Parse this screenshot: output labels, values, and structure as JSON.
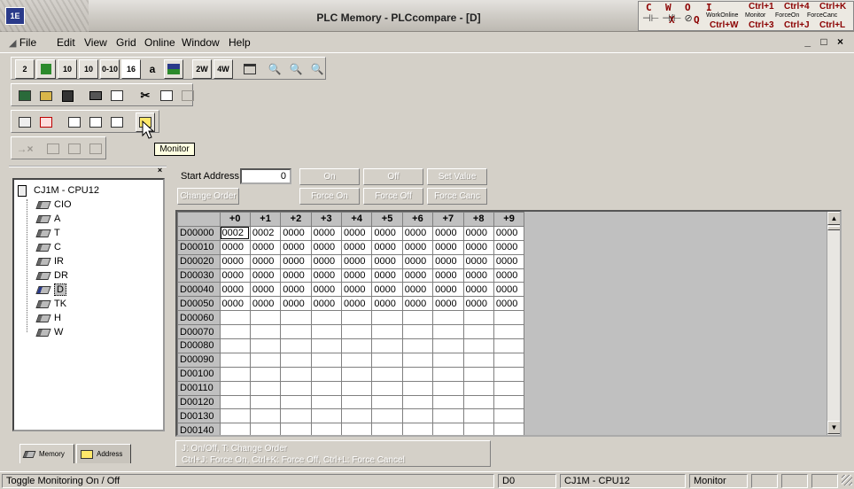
{
  "window": {
    "title": "PLC Memory - PLCcompare - [D]",
    "icon_text": "1E"
  },
  "shortcuts": {
    "glyphs": [
      "C",
      "W",
      "O",
      "I",
      "X",
      "Q"
    ],
    "small_labels": [
      "WorkOnline",
      "Monitor",
      "ForceOn",
      "ForceCanc"
    ],
    "keys_row1": [
      "Ctrl+1",
      "Ctrl+4",
      "Ctrl+K"
    ],
    "keys_row2": [
      "Ctrl+W",
      "Ctrl+3",
      "Ctrl+J",
      "Ctrl+L"
    ]
  },
  "menu": {
    "items": [
      "File",
      "Edit",
      "View",
      "Grid",
      "Online",
      "Window",
      "Help"
    ],
    "mdi_controls": "_ □ ×"
  },
  "toolbar1": {
    "buttons": [
      "2",
      "",
      "10",
      "10",
      "0-10",
      "16",
      "a",
      "",
      "2W",
      "4W",
      "",
      "",
      "",
      ""
    ]
  },
  "tooltip": "Monitor",
  "tree": {
    "root": "CJ1M - CPU12",
    "items": [
      "CIO",
      "A",
      "T",
      "C",
      "IR",
      "DR",
      "D",
      "TK",
      "H",
      "W"
    ],
    "selected": "D"
  },
  "left_tabs": [
    "Memory",
    "Address"
  ],
  "controls": {
    "start_address_label": "Start Address:",
    "start_address_value": "0",
    "buttons_row1": [
      "On",
      "Off",
      "Set Value"
    ],
    "buttons_row2": [
      "Change Order",
      "Force On",
      "Force Off",
      "Force Canc"
    ]
  },
  "grid": {
    "columns": [
      "+0",
      "+1",
      "+2",
      "+3",
      "+4",
      "+5",
      "+6",
      "+7",
      "+8",
      "+9"
    ],
    "rows": [
      {
        "addr": "D00000",
        "values": [
          "0002",
          "0002",
          "0000",
          "0000",
          "0000",
          "0000",
          "0000",
          "0000",
          "0000",
          "0000"
        ]
      },
      {
        "addr": "D00010",
        "values": [
          "0000",
          "0000",
          "0000",
          "0000",
          "0000",
          "0000",
          "0000",
          "0000",
          "0000",
          "0000"
        ]
      },
      {
        "addr": "D00020",
        "values": [
          "0000",
          "0000",
          "0000",
          "0000",
          "0000",
          "0000",
          "0000",
          "0000",
          "0000",
          "0000"
        ]
      },
      {
        "addr": "D00030",
        "values": [
          "0000",
          "0000",
          "0000",
          "0000",
          "0000",
          "0000",
          "0000",
          "0000",
          "0000",
          "0000"
        ]
      },
      {
        "addr": "D00040",
        "values": [
          "0000",
          "0000",
          "0000",
          "0000",
          "0000",
          "0000",
          "0000",
          "0000",
          "0000",
          "0000"
        ]
      },
      {
        "addr": "D00050",
        "values": [
          "0000",
          "0000",
          "0000",
          "0000",
          "0000",
          "0000",
          "0000",
          "0000",
          "0000",
          "0000"
        ]
      },
      {
        "addr": "D00060",
        "values": [
          "",
          "",
          "",
          "",
          "",
          "",
          "",
          "",
          "",
          ""
        ]
      },
      {
        "addr": "D00070",
        "values": [
          "",
          "",
          "",
          "",
          "",
          "",
          "",
          "",
          "",
          ""
        ]
      },
      {
        "addr": "D00080",
        "values": [
          "",
          "",
          "",
          "",
          "",
          "",
          "",
          "",
          "",
          ""
        ]
      },
      {
        "addr": "D00090",
        "values": [
          "",
          "",
          "",
          "",
          "",
          "",
          "",
          "",
          "",
          ""
        ]
      },
      {
        "addr": "D00100",
        "values": [
          "",
          "",
          "",
          "",
          "",
          "",
          "",
          "",
          "",
          ""
        ]
      },
      {
        "addr": "D00110",
        "values": [
          "",
          "",
          "",
          "",
          "",
          "",
          "",
          "",
          "",
          ""
        ]
      },
      {
        "addr": "D00120",
        "values": [
          "",
          "",
          "",
          "",
          "",
          "",
          "",
          "",
          "",
          ""
        ]
      },
      {
        "addr": "D00130",
        "values": [
          "",
          "",
          "",
          "",
          "",
          "",
          "",
          "",
          "",
          ""
        ]
      },
      {
        "addr": "D00140",
        "values": [
          "",
          "",
          "",
          "",
          "",
          "",
          "",
          "",
          "",
          ""
        ]
      }
    ]
  },
  "hint": {
    "line1": "J: On/Off,   T: Change Order",
    "line2": "Ctrl+J: Force On,   Ctrl+K: Force Off,   Ctrl+L: Force Cancel"
  },
  "status": {
    "message": "Toggle Monitoring On / Off",
    "area": "D0",
    "plc": "CJ1M - CPU12",
    "mode": "Monitor"
  }
}
